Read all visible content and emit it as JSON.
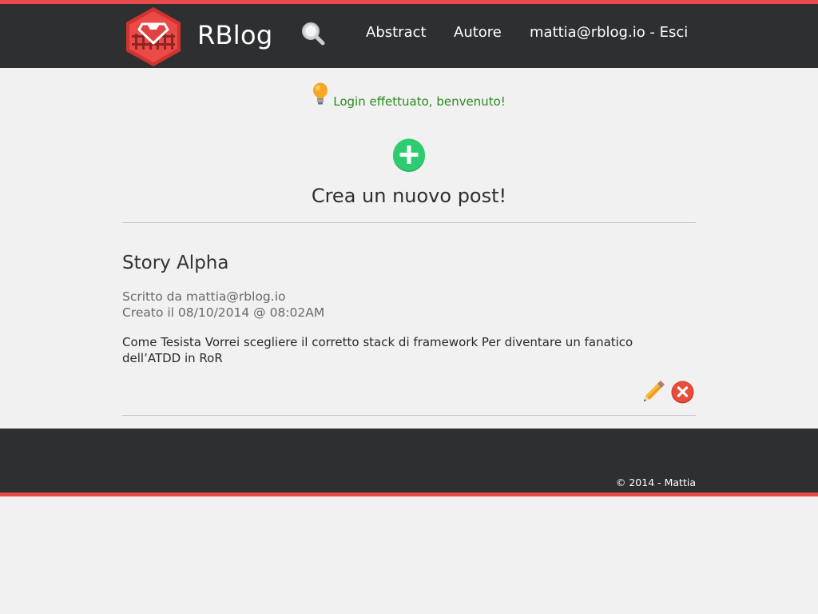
{
  "header": {
    "brand": "RBlog",
    "nav": {
      "abstract": "Abstract",
      "autore": "Autore",
      "user": "mattia@rblog.io - Esci"
    }
  },
  "flash": {
    "message": "Login effettuato, benvenuto!"
  },
  "new_post": {
    "label": "Crea un nuovo post!"
  },
  "posts": [
    {
      "title": "Story Alpha",
      "author_line": "Scritto da mattia@rblog.io",
      "created_line": "Creato il 08/10/2014 @ 08:02AM",
      "body": "Come Tesista Vorrei scegliere il corretto stack di framework Per diventare un fanatico dell’ATDD in RoR"
    }
  ],
  "footer": {
    "copyright": "© 2014 - Mattia"
  },
  "colors": {
    "accent": "#e74c4b",
    "bar": "#2e2f31",
    "background": "#f1f1f1",
    "flash_text": "#2b8a1f",
    "add": "#2ecc71",
    "delete": "#e74c3c"
  },
  "icons": {
    "logo": "ruby-shield-icon",
    "search": "magnifier-icon",
    "flash": "lightbulb-icon",
    "add": "plus-circle-icon",
    "edit": "pencil-icon",
    "delete": "close-circle-icon"
  }
}
